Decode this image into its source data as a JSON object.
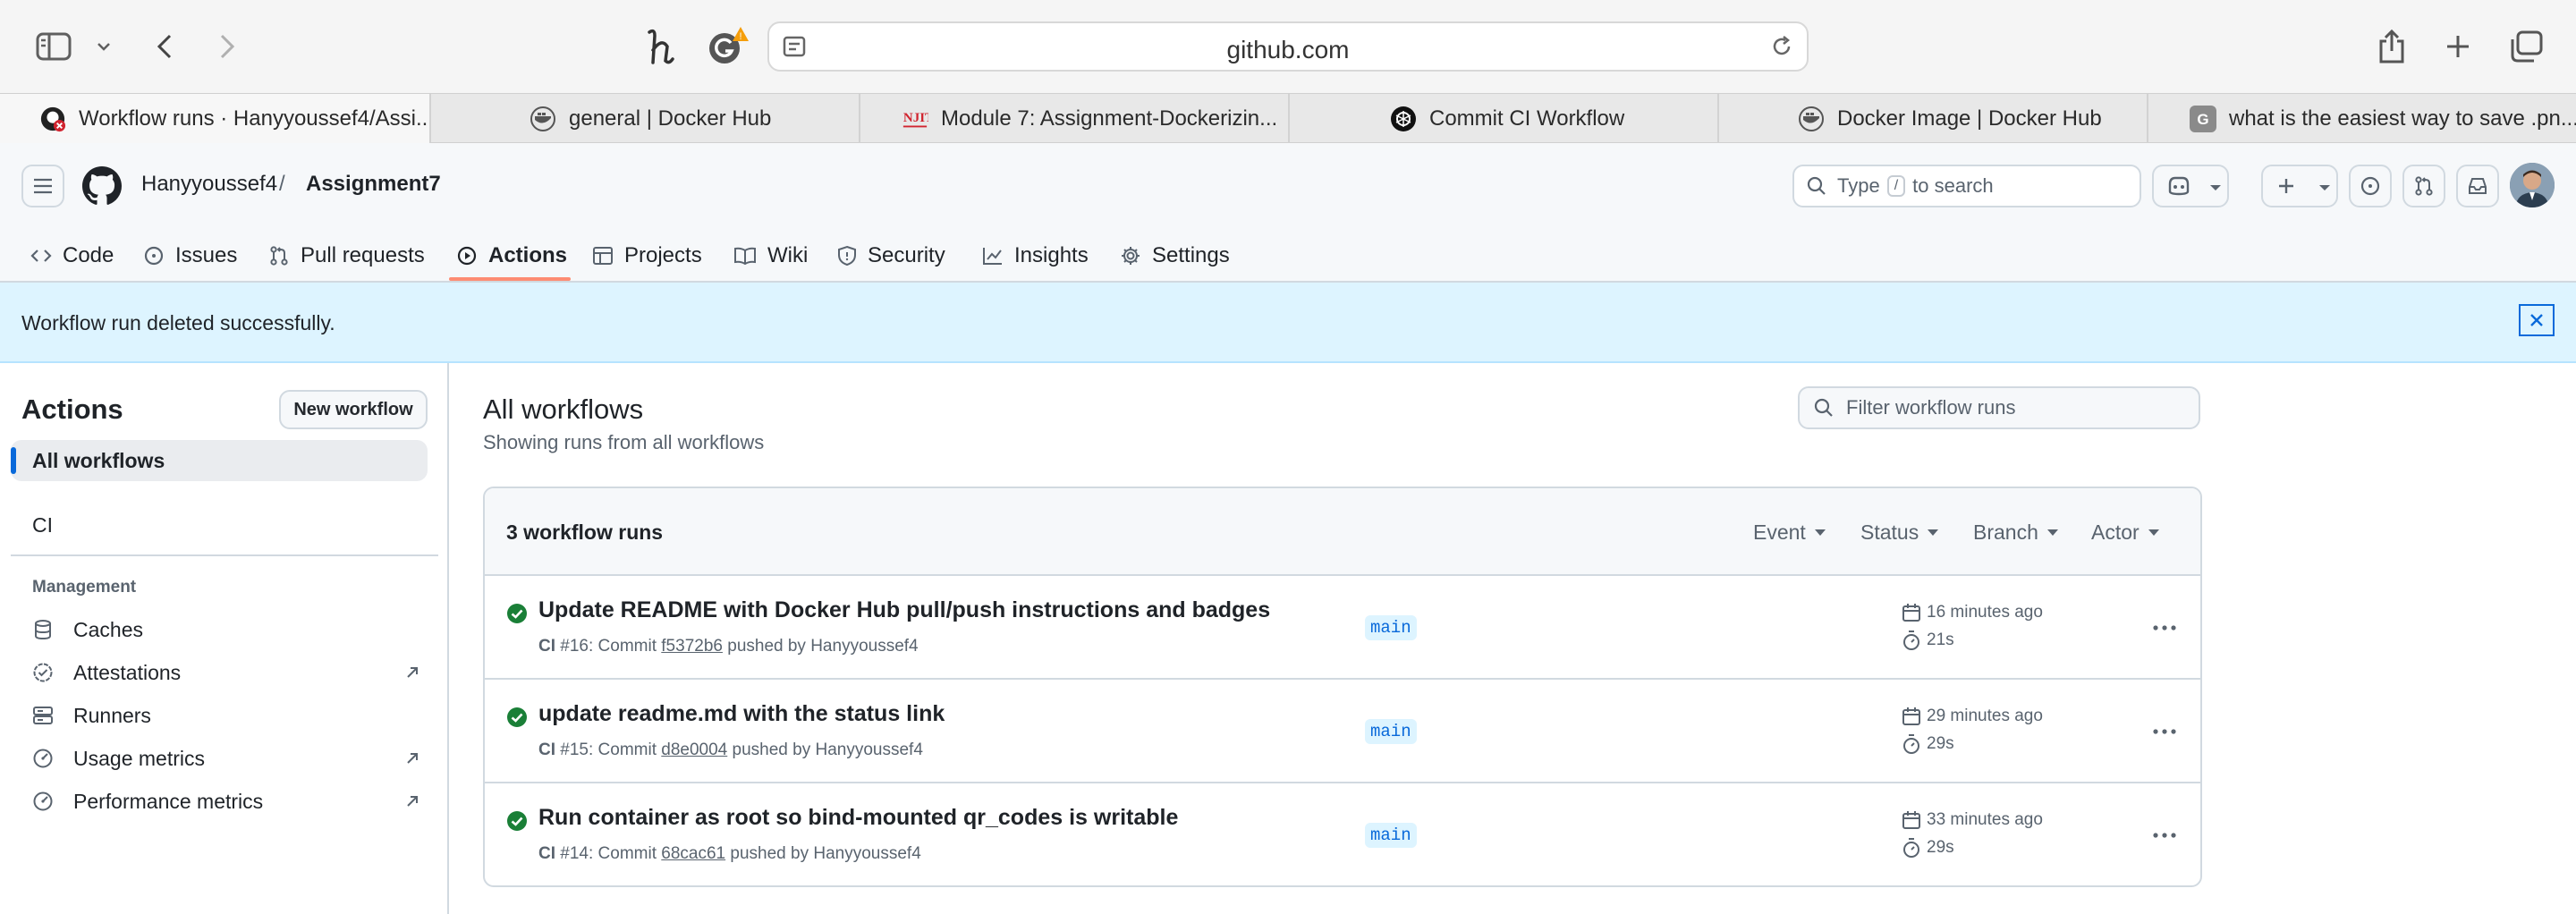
{
  "browser": {
    "url": "github.com",
    "tabs": [
      {
        "label": "Workflow runs · Hanyyoussef4/Assi...",
        "icon": "github-error-icon"
      },
      {
        "label": "general | Docker Hub",
        "icon": "docker-icon"
      },
      {
        "label": "Module 7: Assignment-Dockerizin...",
        "icon": "njit-icon"
      },
      {
        "label": "Commit CI Workflow",
        "icon": "chatgpt-icon"
      },
      {
        "label": "Docker Image | Docker Hub",
        "icon": "docker-icon"
      },
      {
        "label": "what is the easiest way to save .pn...",
        "icon": "google-icon"
      }
    ]
  },
  "header": {
    "owner": "Hanyyoussef4",
    "separator": "/",
    "repo": "Assignment7",
    "search_prefix": "Type",
    "search_key": "/",
    "search_suffix": "to search"
  },
  "repo_nav": [
    {
      "label": "Code",
      "icon": "code-icon"
    },
    {
      "label": "Issues",
      "icon": "issue-icon"
    },
    {
      "label": "Pull requests",
      "icon": "pull-request-icon"
    },
    {
      "label": "Actions",
      "icon": "play-icon"
    },
    {
      "label": "Projects",
      "icon": "table-icon"
    },
    {
      "label": "Wiki",
      "icon": "book-icon"
    },
    {
      "label": "Security",
      "icon": "shield-icon"
    },
    {
      "label": "Insights",
      "icon": "graph-icon"
    },
    {
      "label": "Settings",
      "icon": "gear-icon"
    }
  ],
  "flash": {
    "message": "Workflow run deleted successfully."
  },
  "sidebar": {
    "title": "Actions",
    "new_workflow": "New workflow",
    "all_workflows": "All workflows",
    "workflows": [
      "CI"
    ],
    "management_heading": "Management",
    "management": [
      {
        "label": "Caches",
        "icon": "database-icon",
        "external": false
      },
      {
        "label": "Attestations",
        "icon": "verified-icon",
        "external": true
      },
      {
        "label": "Runners",
        "icon": "server-icon",
        "external": false
      },
      {
        "label": "Usage metrics",
        "icon": "meter-icon",
        "external": true
      },
      {
        "label": "Performance metrics",
        "icon": "meter-icon",
        "external": true
      }
    ]
  },
  "main": {
    "title": "All workflows",
    "subtitle": "Showing runs from all workflows",
    "filter_placeholder": "Filter workflow runs",
    "count_label": "3 workflow runs",
    "filters": [
      "Event",
      "Status",
      "Branch",
      "Actor"
    ],
    "runs": [
      {
        "title": "Update README with Docker Hub pull/push instructions and badges",
        "workflow": "CI",
        "run_number": "#16",
        "commit_label": "Commit",
        "sha": "f5372b6",
        "pushed_by": "pushed by Hanyyoussef4",
        "branch": "main",
        "time_ago": "16 minutes ago",
        "duration": "21s",
        "status": "success"
      },
      {
        "title": "update readme.md with the status link",
        "workflow": "CI",
        "run_number": "#15",
        "commit_label": "Commit",
        "sha": "d8e0004",
        "pushed_by": "pushed by Hanyyoussef4",
        "branch": "main",
        "time_ago": "29 minutes ago",
        "duration": "29s",
        "status": "success"
      },
      {
        "title": "Run container as root so bind-mounted qr_codes is writable",
        "workflow": "CI",
        "run_number": "#14",
        "commit_label": "Commit",
        "sha": "68cac61",
        "pushed_by": "pushed by Hanyyoussef4",
        "branch": "main",
        "time_ago": "33 minutes ago",
        "duration": "29s",
        "status": "success"
      }
    ]
  },
  "colors": {
    "accent": "#0969da",
    "success": "#1a7f37",
    "flash_bg": "#ddf4ff",
    "active_tab_underline": "#fd8c73"
  }
}
